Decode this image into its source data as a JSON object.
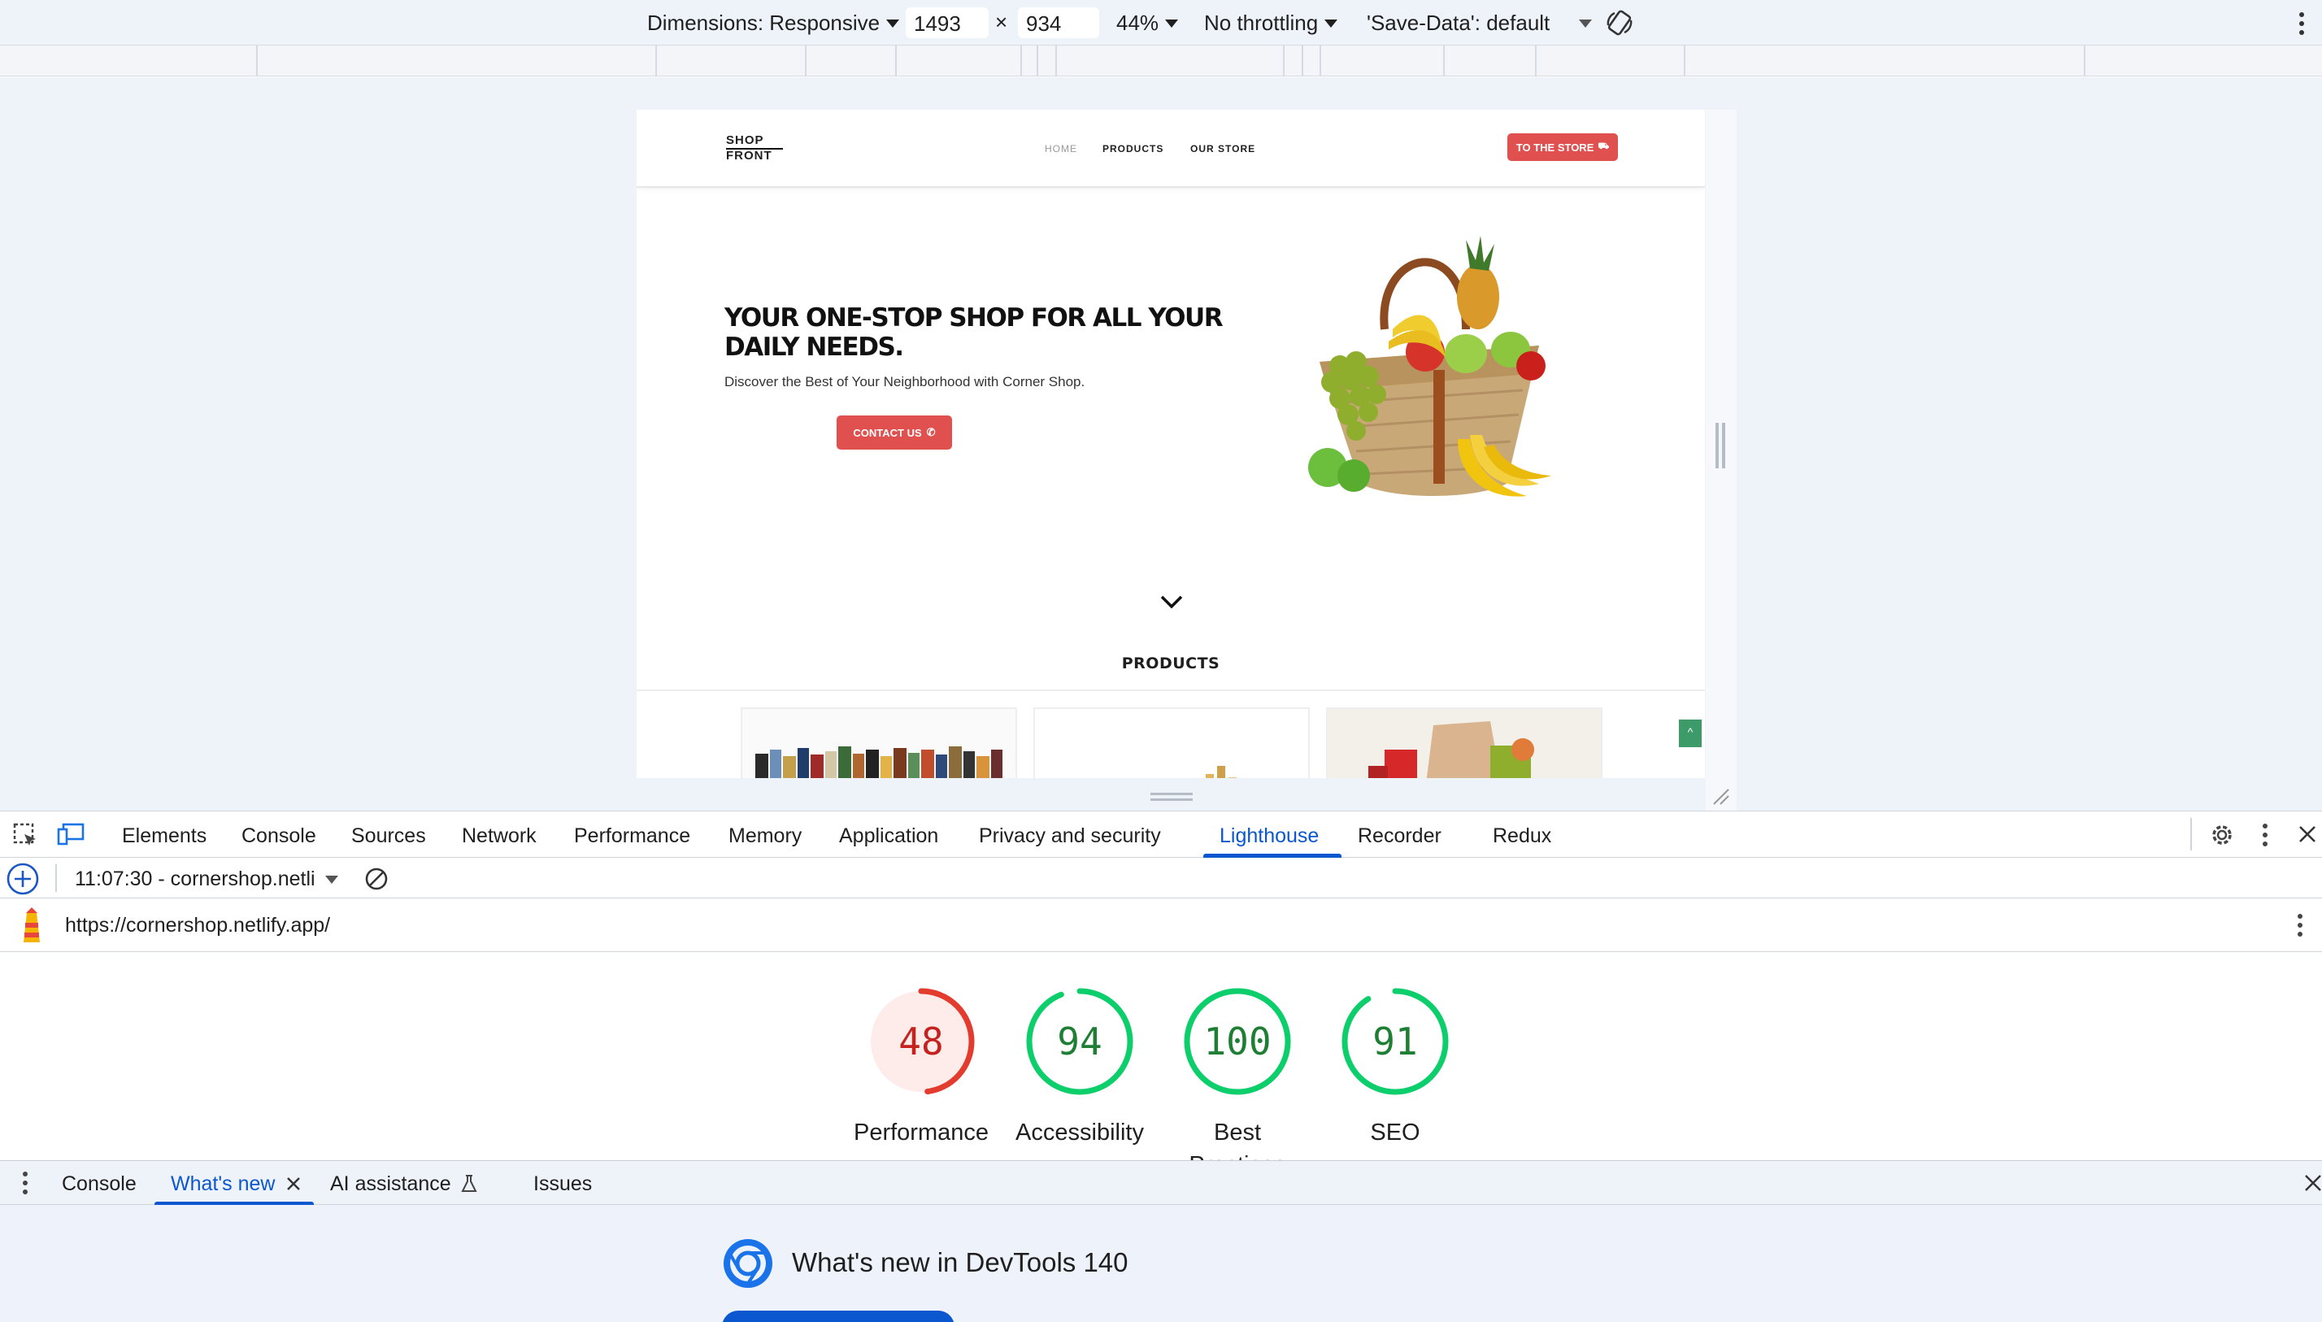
{
  "device_toolbar": {
    "dimensions_label": "Dimensions: Responsive",
    "width": "1493",
    "times": "×",
    "height": "934",
    "zoom": "44%",
    "throttling": "No throttling",
    "save_data": "'Save-Data': default"
  },
  "site": {
    "logo_line1": "SHOP",
    "logo_line2": "FRONT",
    "nav": [
      "HOME",
      "PRODUCTS",
      "OUR STORE"
    ],
    "cta": "TO THE STORE",
    "hero_title": "YOUR ONE-STOP SHOP FOR ALL YOUR DAILY NEEDS.",
    "hero_subtitle": "Discover the Best of Your Neighborhood with Corner Shop.",
    "contact_button": "CONTACT US",
    "products_heading": "PRODUCTS"
  },
  "devtools": {
    "tabs": [
      "Elements",
      "Console",
      "Sources",
      "Network",
      "Performance",
      "Memory",
      "Application",
      "Privacy and security",
      "Lighthouse",
      "Recorder",
      "Redux"
    ],
    "active_tab": "Lighthouse",
    "report_selector": "11:07:30 - cornershop.netli",
    "url": "https://cornershop.netlify.app/",
    "scores": [
      {
        "label": "Performance",
        "value": "48",
        "score": 48,
        "status": "fail"
      },
      {
        "label": "Accessibility",
        "value": "94",
        "score": 94,
        "status": "pass"
      },
      {
        "label": "Best Practices",
        "value": "100",
        "score": 100,
        "status": "pass"
      },
      {
        "label": "SEO",
        "value": "91",
        "score": 91,
        "status": "pass"
      }
    ],
    "colors": {
      "fail": "#e33b2e",
      "fail_bg": "#fdecea",
      "fail_text": "#c5221f",
      "pass": "#0cce6b",
      "pass_text": "#1e7e34",
      "accent": "#1a73e8"
    },
    "drawer_tabs": [
      "Console",
      "What's new",
      "AI assistance",
      "Issues"
    ],
    "drawer_active": "What's new",
    "whats_new_title": "What's new in DevTools 140"
  }
}
